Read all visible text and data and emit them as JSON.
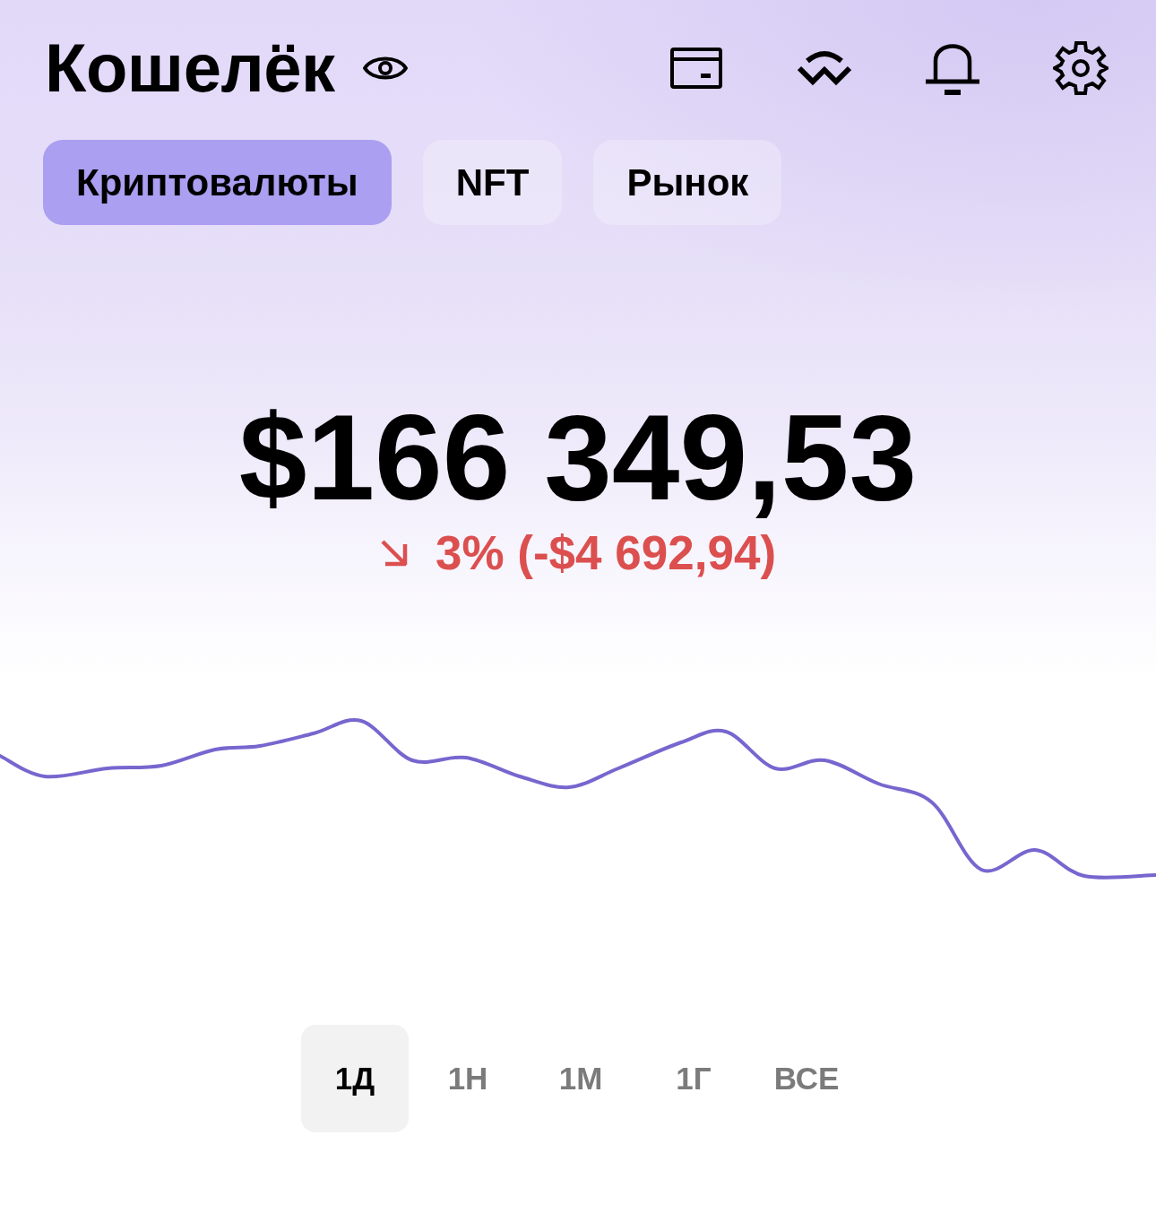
{
  "header": {
    "title": "Кошелёк"
  },
  "tabs": [
    {
      "label": "Криптовалюты",
      "selected": true
    },
    {
      "label": "NFT",
      "selected": false
    },
    {
      "label": "Рынок",
      "selected": false
    }
  ],
  "balance": {
    "amount": "$166 349,53",
    "change": "3% (-$4 692,94)",
    "negative": true
  },
  "ranges": [
    {
      "label": "1Д",
      "selected": true
    },
    {
      "label": "1Н",
      "selected": false
    },
    {
      "label": "1М",
      "selected": false
    },
    {
      "label": "1Г",
      "selected": false
    },
    {
      "label": "ВСЕ",
      "selected": false
    }
  ]
}
